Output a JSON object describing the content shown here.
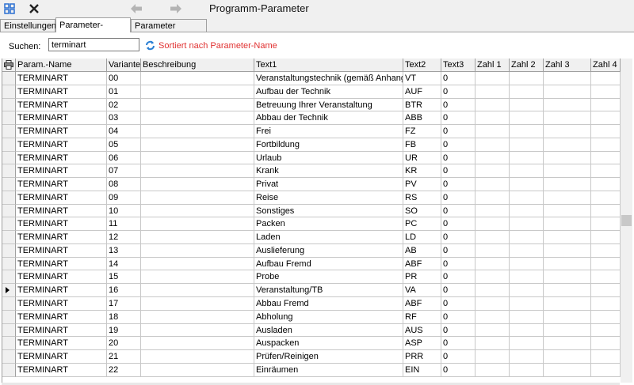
{
  "window": {
    "title": "Programm-Parameter"
  },
  "tabs": [
    {
      "label": "Einstellungen",
      "active": false
    },
    {
      "label": "Parameter-Tabelle",
      "active": true
    },
    {
      "label": "Parameter Eingabe",
      "active": false
    }
  ],
  "search": {
    "label": "Suchen:",
    "value": "terminart",
    "sort_text": "Sortiert nach Parameter-Name"
  },
  "table": {
    "columns": [
      "Param.-Name",
      "Variante",
      "Beschreibung",
      "Text1",
      "Text2",
      "Text3",
      "Zahl 1",
      "Zahl 2",
      "Zahl 3",
      "Zahl 4"
    ],
    "current_row_index": 16,
    "rows": [
      [
        "TERMINART",
        "00",
        "",
        "Veranstaltungstechnik (gemäß Anhang \"I",
        "VT",
        "0"
      ],
      [
        "TERMINART",
        "01",
        "",
        "Aufbau der Technik",
        "AUF",
        "0"
      ],
      [
        "TERMINART",
        "02",
        "",
        "Betreuung Ihrer Veranstaltung",
        "BTR",
        "0"
      ],
      [
        "TERMINART",
        "03",
        "",
        "Abbau der Technik",
        "ABB",
        "0"
      ],
      [
        "TERMINART",
        "04",
        "",
        "Frei",
        "FZ",
        "0"
      ],
      [
        "TERMINART",
        "05",
        "",
        "Fortbildung",
        "FB",
        "0"
      ],
      [
        "TERMINART",
        "06",
        "",
        "Urlaub",
        "UR",
        "0"
      ],
      [
        "TERMINART",
        "07",
        "",
        "Krank",
        "KR",
        "0"
      ],
      [
        "TERMINART",
        "08",
        "",
        "Privat",
        "PV",
        "0"
      ],
      [
        "TERMINART",
        "09",
        "",
        "Reise",
        "RS",
        "0"
      ],
      [
        "TERMINART",
        "10",
        "",
        "Sonstiges",
        "SO",
        "0"
      ],
      [
        "TERMINART",
        "11",
        "",
        "Packen",
        "PC",
        "0"
      ],
      [
        "TERMINART",
        "12",
        "",
        "Laden",
        "LD",
        "0"
      ],
      [
        "TERMINART",
        "13",
        "",
        "Auslieferung",
        "AB",
        "0"
      ],
      [
        "TERMINART",
        "14",
        "",
        "Aufbau Fremd",
        "ABF",
        "0"
      ],
      [
        "TERMINART",
        "15",
        "",
        "Probe",
        "PR",
        "0"
      ],
      [
        "TERMINART",
        "16",
        "",
        "Veranstaltung/TB",
        "VA",
        "0"
      ],
      [
        "TERMINART",
        "17",
        "",
        "Abbau Fremd",
        "ABF",
        "0"
      ],
      [
        "TERMINART",
        "18",
        "",
        "Abholung",
        "RF",
        "0"
      ],
      [
        "TERMINART",
        "19",
        "",
        "Ausladen",
        "AUS",
        "0"
      ],
      [
        "TERMINART",
        "20",
        "",
        "Auspacken",
        "ASP",
        "0"
      ],
      [
        "TERMINART",
        "21",
        "",
        "Prüfen/Reinigen",
        "PRR",
        "0"
      ],
      [
        "TERMINART",
        "22",
        "",
        "Einräumen",
        "EIN",
        "0"
      ]
    ]
  },
  "icons": [
    "grid-icon",
    "close-icon",
    "back-arrow-icon",
    "forward-arrow-icon",
    "refresh-sort-icon",
    "print-icon",
    "row-pointer-icon"
  ],
  "colors": {
    "sort_text": "#e03030",
    "grid_icon": "#2a6fd1"
  }
}
